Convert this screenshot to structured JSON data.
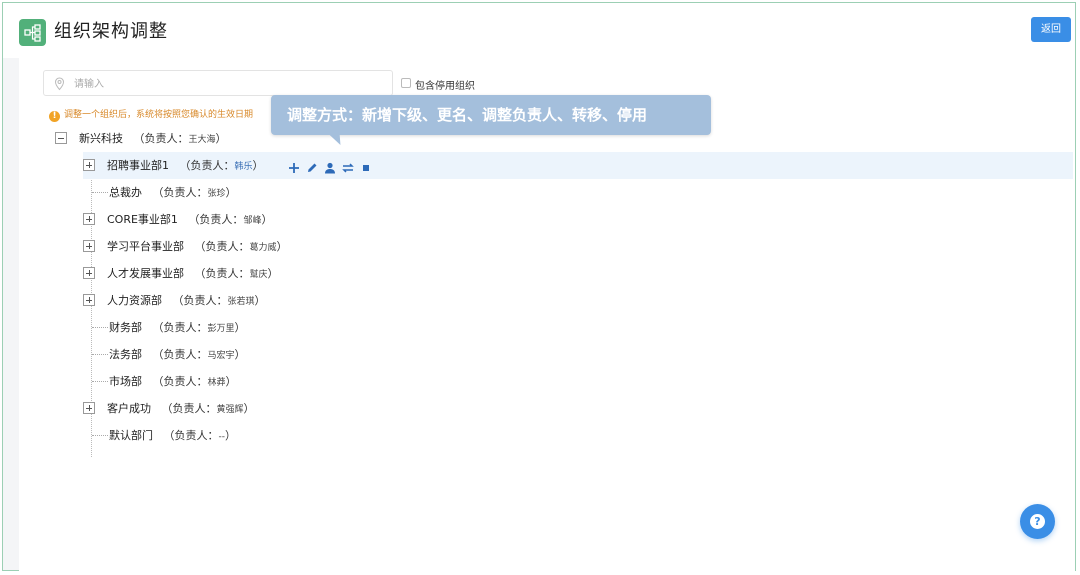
{
  "header": {
    "title": "组织架构调整",
    "app_icon": "org-tree-icon",
    "back_label": "返回"
  },
  "search": {
    "placeholder": "请输入",
    "icon": "location-pin-icon"
  },
  "include_disabled": {
    "label": "包含停用组织",
    "checked": false
  },
  "notice": "调整一个组织后，系统将按照您确认的生效日期",
  "tooltip": "调整方式：新增下级、更名、调整负责人、转移、停用",
  "tree": {
    "root": {
      "name": "新兴科技",
      "lead_prefix": "（负责人：",
      "lead": "王大海",
      "lead_suffix": "）"
    },
    "children": [
      {
        "name": "招聘事业部1",
        "lead_prefix": "（负责人：",
        "lead": "韩乐",
        "lead_suffix": "）",
        "expandable": true,
        "selected": true
      },
      {
        "name": "总裁办",
        "lead_prefix": "（负责人：",
        "lead": "张珍",
        "lead_suffix": "）",
        "expandable": false
      },
      {
        "name": "CORE事业部1",
        "lead_prefix": "（负责人：",
        "lead": "邹峰",
        "lead_suffix": "）",
        "expandable": true
      },
      {
        "name": "学习平台事业部",
        "lead_prefix": "（负责人：",
        "lead": "葛力威",
        "lead_suffix": "）",
        "expandable": true
      },
      {
        "name": "人才发展事业部",
        "lead_prefix": "（负责人：",
        "lead": "幫庆",
        "lead_suffix": "）",
        "expandable": true
      },
      {
        "name": "人力资源部",
        "lead_prefix": "（负责人：",
        "lead": "张若琪",
        "lead_suffix": "）",
        "expandable": true
      },
      {
        "name": "财务部",
        "lead_prefix": "（负责人：",
        "lead": "彭万里",
        "lead_suffix": "）",
        "expandable": false
      },
      {
        "name": "法务部",
        "lead_prefix": "（负责人：",
        "lead": "马宏宇",
        "lead_suffix": "）",
        "expandable": false
      },
      {
        "name": "市场部",
        "lead_prefix": "（负责人：",
        "lead": "林莽",
        "lead_suffix": "）",
        "expandable": false
      },
      {
        "name": "客户成功",
        "lead_prefix": "（负责人：",
        "lead": "黄强辉",
        "lead_suffix": "）",
        "expandable": true
      },
      {
        "name": "默认部门",
        "lead_prefix": "（负责人：",
        "lead": "--",
        "lead_suffix": "）",
        "expandable": false
      }
    ]
  },
  "row_actions": [
    "add-child-icon",
    "rename-pencil-icon",
    "change-leader-person-icon",
    "transfer-arrows-icon",
    "disable-stop-icon"
  ],
  "help_button": "question-help-icon",
  "colors": {
    "accent": "#3a8ee6",
    "brand_green": "#52b07a",
    "notice_orange": "#d8892a",
    "selected_row": "#ecf4fc",
    "tooltip_bg": "#a4bfdc"
  }
}
